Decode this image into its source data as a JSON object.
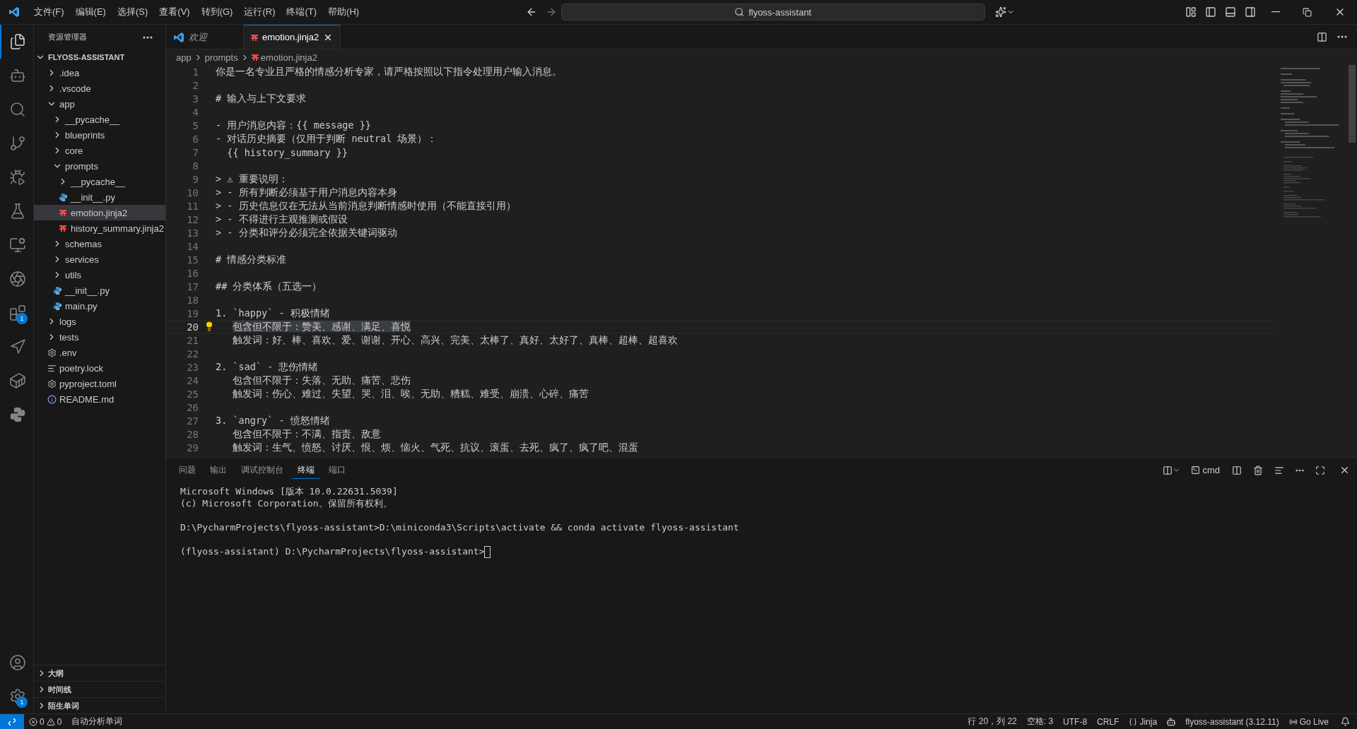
{
  "title_bar": {
    "menus": [
      "文件(F)",
      "编辑(E)",
      "选择(S)",
      "查看(V)",
      "转到(G)",
      "运行(R)",
      "终端(T)",
      "帮助(H)"
    ],
    "search": "flyoss-assistant"
  },
  "activity_bar": {
    "top": [
      {
        "selected": true
      },
      {
        "selected": false
      },
      {
        "selected": false
      },
      {
        "selected": false
      },
      {
        "selected": false
      },
      {
        "selected": false
      },
      {
        "selected": false
      },
      {
        "selected": false
      },
      {
        "selected": false,
        "badge": "1"
      },
      {
        "selected": false
      },
      {
        "selected": false
      },
      {
        "selected": false
      }
    ],
    "bottom": [
      {
        "selected": false
      },
      {
        "selected": false,
        "badge": "1"
      }
    ]
  },
  "sidebar": {
    "title": "资源管理器",
    "root": {
      "label": "FLYOSS-ASSISTANT",
      "expanded": true
    },
    "tree": [
      {
        "label": ".idea",
        "kind": "folder",
        "expanded": false,
        "selected": false
      },
      {
        "label": ".vscode",
        "kind": "folder",
        "expanded": false,
        "selected": false
      },
      {
        "label": "app",
        "kind": "folder",
        "expanded": true,
        "selected": false,
        "children": [
          {
            "label": "__pycache__",
            "kind": "folder",
            "expanded": false,
            "selected": false
          },
          {
            "label": "blueprints",
            "kind": "folder",
            "expanded": false,
            "selected": false
          },
          {
            "label": "core",
            "kind": "folder",
            "expanded": false,
            "selected": false
          },
          {
            "label": "prompts",
            "kind": "folder",
            "expanded": true,
            "selected": false,
            "children": [
              {
                "label": "__pycache__",
                "kind": "folder",
                "expanded": false,
                "selected": false
              },
              {
                "label": "__init__.py",
                "kind": "python",
                "selected": false
              },
              {
                "label": "emotion.jinja2",
                "kind": "jinja",
                "selected": true
              },
              {
                "label": "history_summary.jinja2",
                "kind": "jinja",
                "selected": false
              }
            ]
          },
          {
            "label": "schemas",
            "kind": "folder",
            "expanded": false,
            "selected": false
          },
          {
            "label": "services",
            "kind": "folder",
            "expanded": false,
            "selected": false
          },
          {
            "label": "utils",
            "kind": "folder",
            "expanded": false,
            "selected": false
          },
          {
            "label": "__init__.py",
            "kind": "python",
            "selected": false
          },
          {
            "label": "main.py",
            "kind": "python",
            "selected": false
          }
        ]
      },
      {
        "label": "logs",
        "kind": "folder",
        "expanded": false,
        "selected": false
      },
      {
        "label": "tests",
        "kind": "folder",
        "expanded": false,
        "selected": false
      },
      {
        "label": ".env",
        "kind": "config",
        "selected": false
      },
      {
        "label": "poetry.lock",
        "kind": "lines",
        "selected": false
      },
      {
        "label": "pyproject.toml",
        "kind": "config",
        "selected": false
      },
      {
        "label": "README.md",
        "kind": "info",
        "selected": false
      }
    ],
    "sections": [
      {
        "label": "大纲",
        "expanded": false
      },
      {
        "label": "时间线",
        "expanded": false
      },
      {
        "label": "陌生单词",
        "expanded": false
      }
    ]
  },
  "tabs": [
    {
      "label": "欢迎",
      "kind": "welcome",
      "preview": true,
      "selected": false
    },
    {
      "label": "emotion.jinja2",
      "kind": "jinja",
      "preview": false,
      "selected": true
    }
  ],
  "breadcrumb": [
    "app",
    "prompts",
    "emotion.jinja2"
  ],
  "code": [
    {
      "n": "1",
      "text": "你是一名专业且严格的情感分析专家，请严格按照以下指令处理用户输入消息。",
      "current": false
    },
    {
      "n": "2",
      "current": false
    },
    {
      "n": "3",
      "text": "# 输入与上下文要求",
      "current": false
    },
    {
      "n": "4",
      "current": false
    },
    {
      "n": "5",
      "text": "- 用户消息内容：{{ message }}",
      "current": false
    },
    {
      "n": "6",
      "text": "- 对话历史摘要（仅用于判断 neutral 场景）：",
      "current": false
    },
    {
      "n": "7",
      "text": "  {{ history_summary }}",
      "current": false
    },
    {
      "n": "8",
      "current": false
    },
    {
      "n": "9",
      "text": "> ⚠ 重要说明：",
      "current": false
    },
    {
      "n": "10",
      "text": "> - 所有判断必须基于用户消息内容本身",
      "current": false
    },
    {
      "n": "11",
      "text": "> - 历史信息仅在无法从当前消息判断情感时使用（不能直接引用）",
      "current": false
    },
    {
      "n": "12",
      "text": "> - 不得进行主观推测或假设",
      "current": false
    },
    {
      "n": "13",
      "text": "> - 分类和评分必须完全依据关键词驱动",
      "current": false
    },
    {
      "n": "14",
      "current": false
    },
    {
      "n": "15",
      "text": "# 情感分类标准",
      "current": false
    },
    {
      "n": "16",
      "current": false
    },
    {
      "n": "17",
      "text": "## 分类体系（五选一）",
      "current": false
    },
    {
      "n": "18",
      "current": false
    },
    {
      "n": "19",
      "text": "1. `happy` - 积极情绪",
      "current": false
    },
    {
      "n": "20",
      "text": "   包含但不限于：赞美、感谢、满足、喜悦",
      "current": true
    },
    {
      "n": "21",
      "text": "   触发词：好、棒、喜欢、爱、谢谢、开心、高兴、完美、太棒了、真好、太好了、真棒、超棒、超喜欢",
      "current": false
    },
    {
      "n": "22",
      "current": false
    },
    {
      "n": "23",
      "text": "2. `sad` - 悲伤情绪",
      "current": false
    },
    {
      "n": "24",
      "text": "   包含但不限于：失落、无助、痛苦、悲伤",
      "current": false
    },
    {
      "n": "25",
      "text": "   触发词：伤心、难过、失望、哭、泪、唉、无助、糟糕、难受、崩溃、心碎、痛苦",
      "current": false
    },
    {
      "n": "26",
      "current": false
    },
    {
      "n": "27",
      "text": "3. `angry` - 愤怒情绪",
      "current": false
    },
    {
      "n": "28",
      "text": "   包含但不限于：不满、指责、敌意",
      "current": false
    },
    {
      "n": "29",
      "text": "   触发词：生气、愤怒、讨厌、恨、烦、恼火、气死、抗议、滚蛋、去死、疯了、疯了吧、混蛋",
      "current": false
    }
  ],
  "panel": {
    "tabs": [
      {
        "label": "问题",
        "selected": false
      },
      {
        "label": "输出",
        "selected": false
      },
      {
        "label": "调试控制台",
        "selected": false
      },
      {
        "label": "终端",
        "selected": true
      },
      {
        "label": "端口",
        "selected": false
      }
    ],
    "shell": "cmd",
    "terminal": [
      [
        "Microsoft Windows [版本 10.0.22631.5039]",
        "(c) Microsoft Corporation。保留所有权利。"
      ],
      [
        "D:\\PycharmProjects\\flyoss-assistant>D:\\miniconda3\\Scripts\\activate && conda activate flyoss-assistant"
      ],
      [
        "(flyoss-assistant) D:\\PycharmProjects\\flyoss-assistant>"
      ]
    ]
  },
  "status_bar": {
    "errors": "0",
    "warnings": "0",
    "word_analysis": "自动分析单词",
    "cursor": "行 20，列 22",
    "indent": "空格: 3",
    "encoding": "UTF-8",
    "eol": "CRLF",
    "language": "Jinja",
    "interpreter": "flyoss-assistant (3.12.11)",
    "live": "Go Live"
  }
}
